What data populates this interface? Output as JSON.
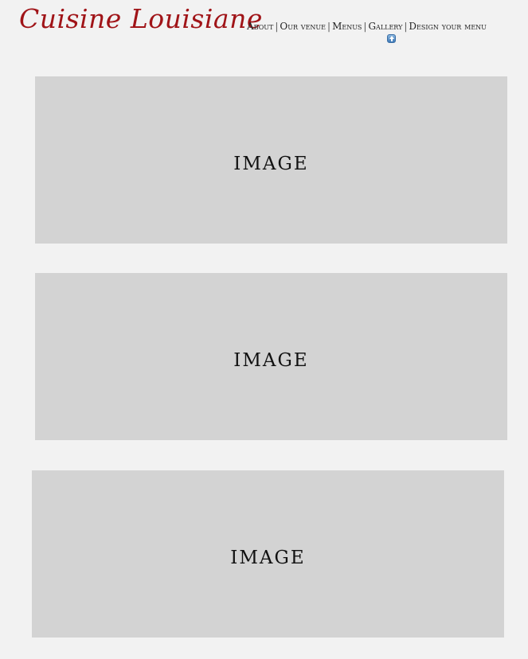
{
  "header": {
    "logo_text": "Cuisine Louisiane",
    "brand_color": "#a01418"
  },
  "nav": {
    "items": [
      {
        "label": "About"
      },
      {
        "label": "Our venue"
      },
      {
        "label": "Menus"
      },
      {
        "label": "Gallery"
      },
      {
        "label": "Design your menu"
      }
    ],
    "separator": "|",
    "scroll_top_icon": "up-arrow-icon"
  },
  "panels": [
    {
      "label": "image"
    },
    {
      "label": "image"
    },
    {
      "label": "image"
    }
  ],
  "colors": {
    "page_background": "#f2f2f2",
    "panel_background": "#d3d3d3"
  }
}
